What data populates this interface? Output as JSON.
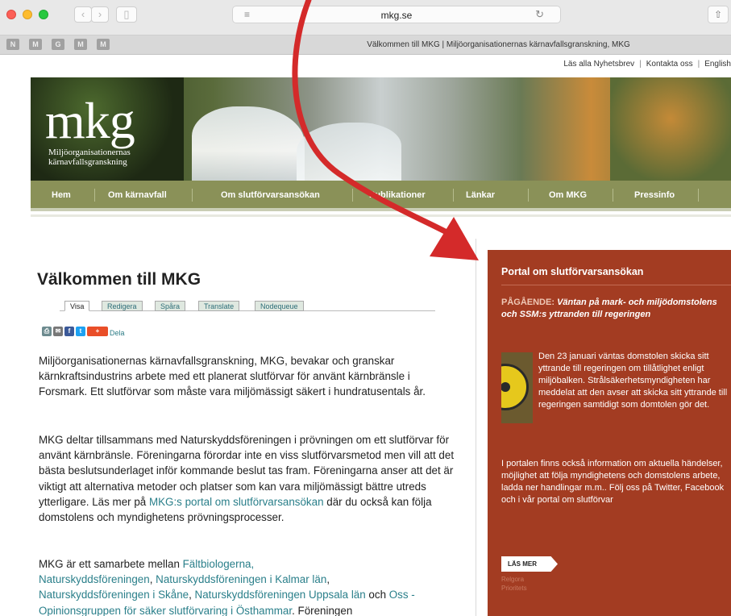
{
  "browser": {
    "url": "mkg.se",
    "tab_title": "Välkommen till MKG | Miljöorganisationernas kärnavfallsgranskning, MKG",
    "bookmarks": [
      "N",
      "M",
      "G",
      "M",
      "M"
    ]
  },
  "top_links": [
    "Läs alla Nyhetsbrev",
    "Kontakta oss",
    "English"
  ],
  "logo": {
    "text": "mkg",
    "subtitle_line1": "Miljöorganisationernas",
    "subtitle_line2": "kärnavfallsgranskning"
  },
  "nav": [
    "Hem",
    "Om kärnavfall",
    "Om slutförvarsansökan",
    "Publikationer",
    "Länkar",
    "Om MKG",
    "Pressinfo"
  ],
  "main": {
    "title": "Välkommen till MKG",
    "tabs": [
      "Visa",
      "Redigera",
      "Spåra",
      "Translate",
      "Nodequeue"
    ],
    "share_label": "Dela",
    "p1": "Miljöorganisationernas kärnavfallsgranskning, MKG, bevakar och granskar kärnkraftsindustrins arbete med ett planerat slutförvar för använt kärnbränsle i Forsmark. Ett slutförvar som måste vara miljömässigt säkert i hundratusentals år.",
    "p2_a": "MKG deltar tillsammans med Naturskyddsföreningen i prövningen om ett slutförvar för använt kärnbränsle. Föreningarna förordar inte en viss slutförvarsmetod men vill att det bästa beslutsunderlaget inför kommande beslut tas fram. Föreningarna anser att det är viktigt att alternativa metoder och platser som kan vara miljömässigt bättre utreds ytterligare. Läs mer på ",
    "p2_link": "MKG:s portal om slutförvarsansökan",
    "p2_b": " där du också kan följa domstolens och myndighetens prövningsprocesser.",
    "p3_a": "MKG är ett samarbete mellan ",
    "p3_l1": "Fältbiologerna,",
    "p3_l2": "Naturskyddsföreningen",
    "p3_sep1": ", ",
    "p3_l3": "Naturskyddsföreningen i Kalmar län",
    "p3_sep2": ",",
    "p3_l4": "Naturskyddsföreningen i Skåne",
    "p3_sep3": ", ",
    "p3_l5": "Naturskyddsföreningen Uppsala län",
    "p3_and": " och ",
    "p3_l6": "Oss - Opinionsgruppen för säker slutförvaring i Östhammar",
    "p3_end": ". Föreningen"
  },
  "portal": {
    "title": "Portal om slutförvarsansökan",
    "ongoing_label": "PÅGÅENDE:",
    "ongoing_text": " Väntan på mark- och miljödomstolens och SSM:s yttranden till regeringen",
    "news": "Den 23 januari väntas domstolen skicka sitt yttrande till regeringen om tillåtlighet enligt miljöbalken. Strålsäkerhetsmyndigheten har meddelat att den avser att skicka sitt yttrande till regeringen samtidigt som domtolen gör det.",
    "more_text": "I portalen finns också information om aktuella händelser, möjlighet att följa myndighetens och domstolens arbete, ladda ner handlingar m.m.. Följ oss på Twitter, Facebook och i vår portal om slutförvar",
    "button": "LÄS MER",
    "small_1": "Relgora",
    "small_2": "Prioritets"
  },
  "colors": {
    "nav_bg": "#8a9158",
    "portal_bg": "#a33c22",
    "link": "#2a7f8a",
    "arrow": "#d42a2a"
  }
}
